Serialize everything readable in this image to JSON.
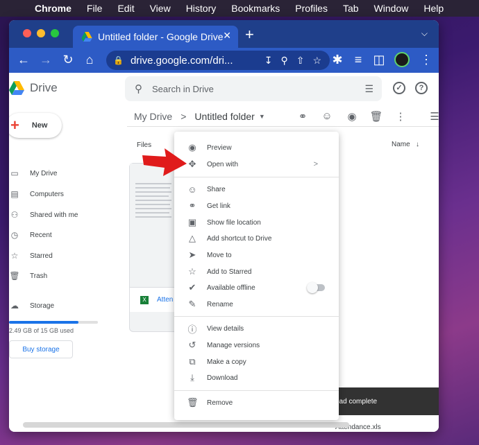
{
  "menubar": {
    "items": [
      "Chrome",
      "File",
      "Edit",
      "View",
      "History",
      "Bookmarks",
      "Profiles",
      "Tab",
      "Window",
      "Help"
    ]
  },
  "browser": {
    "tab_title": "Untitled folder - Google Drive",
    "url": "drive.google.com/dri...",
    "tab_close": "✕",
    "new_tab": "+"
  },
  "drive": {
    "app_name": "Drive",
    "search_placeholder": "Search in Drive",
    "new_label": "New",
    "nav": [
      "My Drive",
      "Computers",
      "Shared with me",
      "Recent",
      "Starred",
      "Trash"
    ],
    "storage_label": "Storage",
    "storage_fraction": 0.78,
    "storage_text": "2.49 GB of 15 GB used",
    "buy_storage": "Buy storage",
    "breadcrumb_root": "My Drive",
    "breadcrumb_sep": ">",
    "breadcrumb_current": "Untitled folder",
    "files_label": "Files",
    "sort_label": "Name",
    "sort_arrow": "↓",
    "file_name": "Atten",
    "toast_text": "oad complete",
    "download_item": "Attendance.xls"
  },
  "context_menu": {
    "groups": [
      [
        "Preview",
        "Open with"
      ],
      [
        "Share",
        "Get link",
        "Show file location",
        "Add shortcut to Drive",
        "Move to",
        "Add to Starred",
        "Available offline",
        "Rename"
      ],
      [
        "View details",
        "Manage versions",
        "Make a copy",
        "Download"
      ],
      [
        "Remove"
      ]
    ],
    "open_with_chevron": ">",
    "available_offline_toggle": false
  },
  "colors": {
    "chrome_tab": "#2d5bc5",
    "chrome_frame": "#1f3f8a",
    "accent": "#1a73e8",
    "arrow": "#e01b1b"
  }
}
